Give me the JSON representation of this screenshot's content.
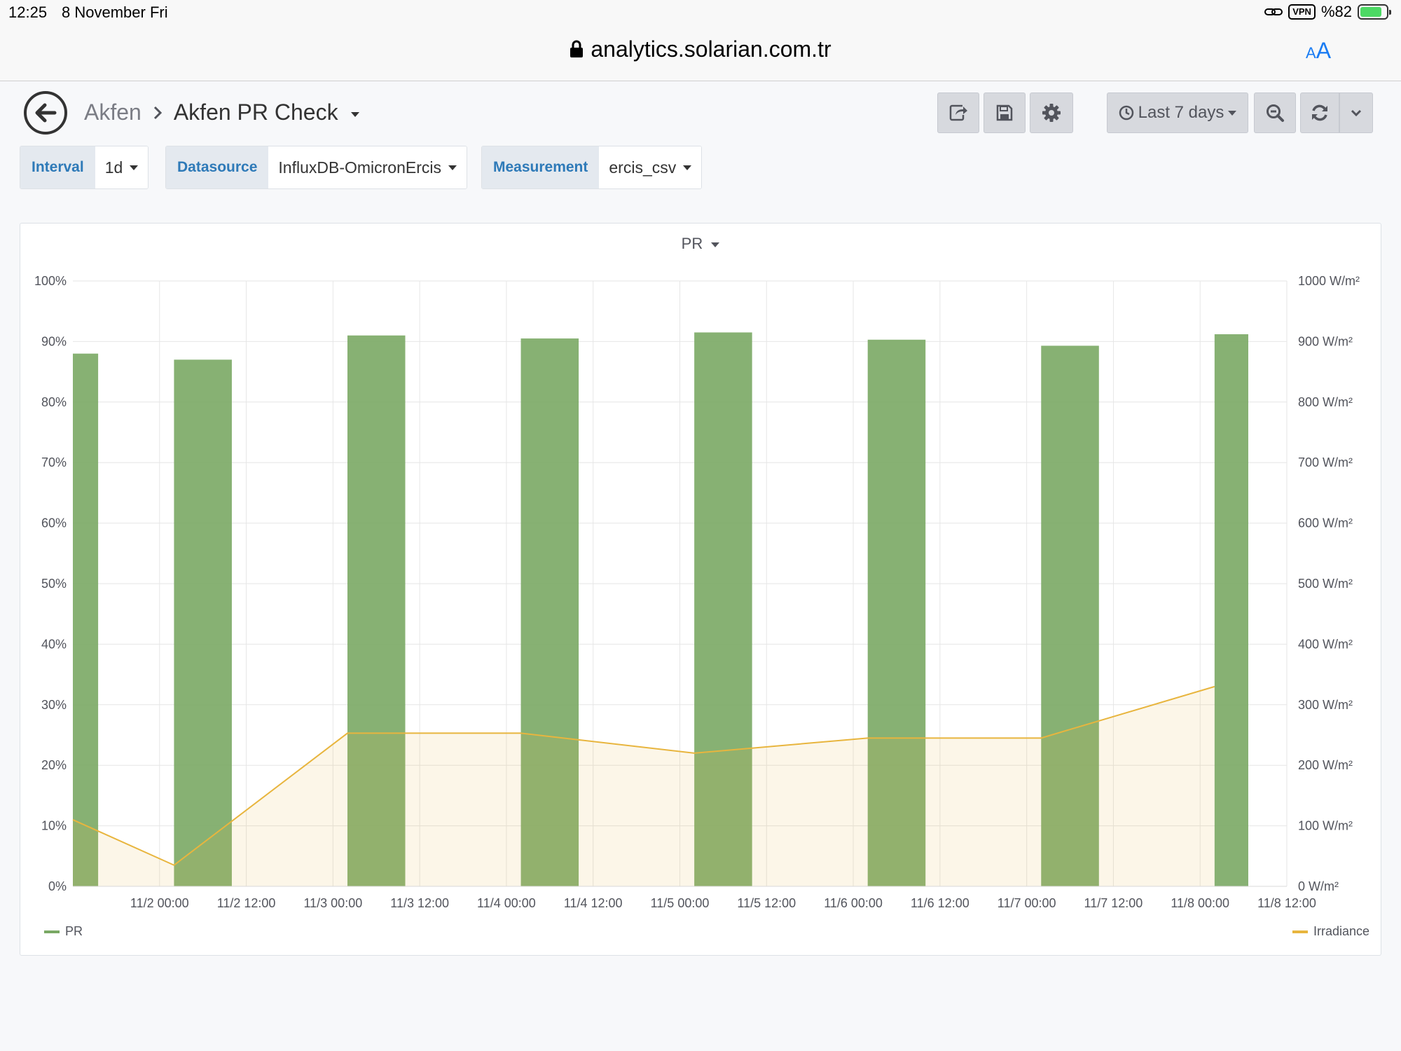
{
  "statusbar": {
    "time": "12:25",
    "date": "8 November Fri",
    "vpn": "VPN",
    "battery": "%82"
  },
  "browser": {
    "url": "analytics.solarian.com.tr",
    "text_size_icon": "text-size-icon",
    "lock_icon": "lock-icon"
  },
  "dashboard": {
    "folder": "Akfen",
    "title": "Akfen PR Check",
    "time_range": "Last 7 days",
    "icons": [
      "back-arrow-icon",
      "share-icon",
      "save-icon",
      "gear-icon",
      "clock-icon",
      "zoom-out-icon",
      "refresh-icon",
      "chevron-down-icon"
    ]
  },
  "variables": [
    {
      "label": "Interval",
      "value": "1d"
    },
    {
      "label": "Datasource",
      "value": "InfluxDB-OmicronErcis"
    },
    {
      "label": "Measurement",
      "value": "ercis_csv"
    }
  ],
  "panel": {
    "title": "PR"
  },
  "colors": {
    "pr": "#7aa864",
    "irradiance": "#e8b53e",
    "irradiance_fill": "#fbf4e4",
    "accent": "#2e7ab8"
  },
  "chart_data": {
    "type": "bar",
    "title": "PR",
    "x_ticks": [
      "11/2 00:00",
      "11/2 12:00",
      "11/3 00:00",
      "11/3 12:00",
      "11/4 00:00",
      "11/4 12:00",
      "11/5 00:00",
      "11/5 12:00",
      "11/6 00:00",
      "11/6 12:00",
      "11/7 00:00",
      "11/7 12:00",
      "11/8 00:00",
      "11/8 12:00"
    ],
    "xlim": [
      "11/1 12:00",
      "11/8 12:00"
    ],
    "y_left": {
      "ticks": [
        "0%",
        "10%",
        "20%",
        "30%",
        "40%",
        "50%",
        "60%",
        "70%",
        "80%",
        "90%",
        "100%"
      ],
      "ylim": [
        0,
        100
      ]
    },
    "y_right": {
      "ticks": [
        "0 W/m²",
        "100 W/m²",
        "200 W/m²",
        "300 W/m²",
        "400 W/m²",
        "500 W/m²",
        "600 W/m²",
        "700 W/m²",
        "800 W/m²",
        "900 W/m²",
        "1000 W/m²"
      ],
      "ylim": [
        0,
        1000
      ]
    },
    "grid": true,
    "legend_placement": "bottom",
    "series": [
      {
        "name": "PR",
        "kind": "bar",
        "axis": "left",
        "unit": "%",
        "points": [
          {
            "start": "11/1 12:00",
            "end": "11/1 15:30",
            "value": 88.0
          },
          {
            "start": "11/2 02:00",
            "end": "11/2 10:00",
            "value": 87.0
          },
          {
            "start": "11/3 02:00",
            "end": "11/3 10:00",
            "value": 91.0
          },
          {
            "start": "11/4 02:00",
            "end": "11/4 10:00",
            "value": 90.5
          },
          {
            "start": "11/5 02:00",
            "end": "11/5 10:00",
            "value": 91.5
          },
          {
            "start": "11/6 02:00",
            "end": "11/6 10:00",
            "value": 90.3
          },
          {
            "start": "11/7 02:00",
            "end": "11/7 10:00",
            "value": 89.3
          },
          {
            "start": "11/8 02:00",
            "end": "11/8 06:40",
            "value": 91.2
          }
        ]
      },
      {
        "name": "Irradiance",
        "kind": "line-area",
        "axis": "right",
        "unit": "W/m²",
        "points": [
          {
            "x": "11/1 12:00",
            "value": 110
          },
          {
            "x": "11/2 02:00",
            "value": 35
          },
          {
            "x": "11/3 02:00",
            "value": 253
          },
          {
            "x": "11/4 02:00",
            "value": 253
          },
          {
            "x": "11/5 02:00",
            "value": 220
          },
          {
            "x": "11/6 02:00",
            "value": 245
          },
          {
            "x": "11/7 02:00",
            "value": 245
          },
          {
            "x": "11/8 02:00",
            "value": 330
          }
        ]
      }
    ]
  }
}
